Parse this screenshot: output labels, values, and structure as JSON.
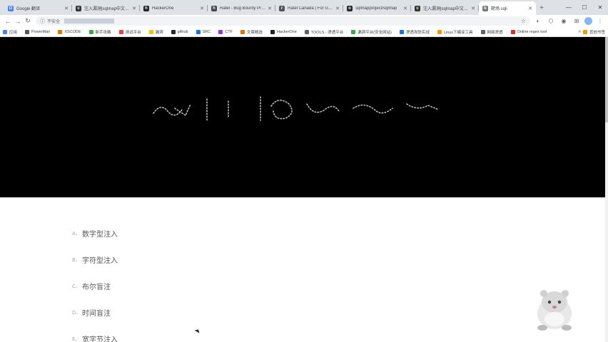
{
  "tabs": [
    {
      "title": "Google 翻译",
      "icon_color": "#4285f4",
      "icon": "G"
    },
    {
      "title": "注入漏洞|sqlmap中文手册",
      "icon_color": "#333333",
      "icon": "c"
    },
    {
      "title": "HackerOne",
      "icon_color": "#222222",
      "icon": "h"
    },
    {
      "title": "Ratel - Bug Bounty Prog",
      "icon_color": "#444444",
      "icon": "h"
    },
    {
      "title": "Ratel Canada | For Game",
      "icon_color": "#555555",
      "icon": "r"
    },
    {
      "title": "sqlmapproject/sqlmap",
      "icon_color": "#24292e",
      "icon": "o"
    },
    {
      "title": "注入漏洞|sqlmap中文手册",
      "icon_color": "#333333",
      "icon": "c"
    },
    {
      "title": "靶场.sqli",
      "icon_color": "#777777",
      "icon": "b",
      "active": true
    }
  ],
  "toolbar": {
    "security_label": "不安全",
    "back_icon": "arrow-left-icon",
    "forward_icon": "arrow-right-icon",
    "reload_icon": "reload-icon"
  },
  "bookmarks": [
    {
      "label": "应用",
      "color": "#4285f4"
    },
    {
      "label": "PowerMan",
      "color": "#555555"
    },
    {
      "label": "XSCODE",
      "color": "#e37400"
    },
    {
      "label": "新手攻略",
      "color": "#34a853"
    },
    {
      "label": "测试平台",
      "color": "#ea4335"
    },
    {
      "label": "漏洞",
      "color": "#fbbc04"
    },
    {
      "label": "github",
      "color": "#24292e"
    },
    {
      "label": "SRC",
      "color": "#1a73e8"
    },
    {
      "label": "CTF",
      "color": "#9334e6"
    },
    {
      "label": "文章精选",
      "color": "#e37400"
    },
    {
      "label": "HackerOne",
      "color": "#222222"
    },
    {
      "label": "TOOLS - 渗透平台",
      "color": "#5f6368"
    },
    {
      "label": "漏洞平台(安全网站)",
      "color": "#34a853"
    },
    {
      "label": "渗透攻防实战",
      "color": "#1a73e8"
    },
    {
      "label": "Linux下编译工具",
      "color": "#f29900"
    },
    {
      "label": "网络渗透",
      "color": "#5f6368"
    },
    {
      "label": "Online regex tool",
      "color": "#d93025"
    }
  ],
  "bookmarks_other": "其他书签",
  "toc": [
    {
      "num": "A、",
      "label": "数字型注入"
    },
    {
      "num": "B、",
      "label": "字符型注入"
    },
    {
      "num": "C、",
      "label": "布尔盲注"
    },
    {
      "num": "D、",
      "label": "时间盲注"
    },
    {
      "num": "E、",
      "label": "宽字节注入"
    }
  ],
  "colors": {
    "hero_bg": "#000000",
    "toc_text": "#555555"
  }
}
